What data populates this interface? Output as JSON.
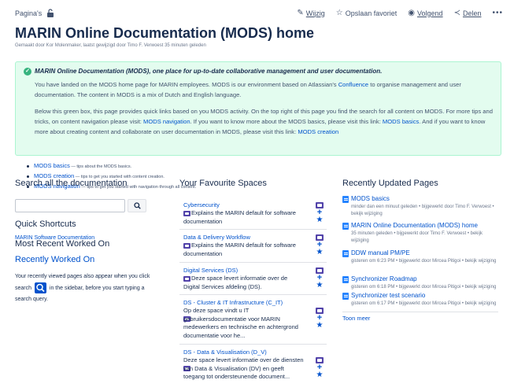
{
  "breadcrumb": {
    "label": "Pagina's"
  },
  "actions": [
    {
      "label": "Wijzig",
      "icon": "pencil-icon"
    },
    {
      "label": "Opslaan favoriet",
      "icon": "star-icon"
    },
    {
      "label": "Volgend",
      "icon": "eye-icon"
    },
    {
      "label": "Delen",
      "icon": "share-icon"
    }
  ],
  "page": {
    "title": "MARIN Online Documentation (MODS) home",
    "byline": "Gemaakt door Kor Molenmaker, laatst gewijzigd door Timo F. Verwoest 35 minuten geleden"
  },
  "panel": {
    "heading": "MARIN Online Documentation (MODS), one place for up-to-date collaborative management and user documentation.",
    "p1_a": "You have landed on the MODS home page for MARIN employees. MODS is our environment based on Atlassian's ",
    "p1_link": "Confluence",
    "p1_b": " to organise management and user documentation. The content in MODS is a mix of Dutch and English language.",
    "p2_a": "Below this green box, this page provides quick links based on you MODS activity. On the top right of this page you find the search for all content on MODS. For more tips and tricks, on content navigation please visit: ",
    "p2_link1": "MODS navigation",
    "p2_b": ". If you want to know more about the MODS basics, please visit this link: ",
    "p2_link2": "MODS basics",
    "p2_c": ". And if you want to know more about creating content and collaborate on user documentation in MODS, please visit this link: ",
    "p2_link3": "MODS creation"
  },
  "quicklinks": [
    {
      "label": "MODS basics",
      "desc": " — tips about the MODS basics."
    },
    {
      "label": "MODS creation",
      "desc": " — tips to get you started with content creation."
    },
    {
      "label": "MODS navigation",
      "desc": " — tips to get you started with navigation through all content."
    }
  ],
  "left": {
    "search_heading": "Search all the documentation",
    "search_placeholder": "",
    "shortcuts_heading": "Quick Shortcuts",
    "shortcut_link": "MARIN Software Documentation",
    "recent_heading": "Most Recent Worked On",
    "recently_worked_on": "Recently Worked On",
    "rwo_a": "Your recently viewed pages also appear when you click search ",
    "rwo_b": " in the sidebar, before you start typing a search query."
  },
  "spaces": {
    "heading": "Your Favourite Spaces",
    "items": [
      {
        "name": "Cybersecurity",
        "desc": "Explains the MARIN default for software documentation"
      },
      {
        "name": "Data & Delivery Workflow",
        "desc": "Explains the MARIN default for software documentation"
      },
      {
        "name": "Digital Services (DS)",
        "desc": "Deze space levert informatie over de Digital Services afdeling (DS)."
      },
      {
        "name": "DS - Cluster & IT Infrastructure (C_IT)",
        "desc": "Op deze space vindt u IT gebruikersdocumentatie voor MARIN medewerkers en technische en achtergrond documentatie voor he..."
      },
      {
        "name": "DS - Data & Visualisation (D_V)",
        "desc": "Deze space levert informatie over de diensten van Data & Visualisation (DV) en geeft toegang tot ondersteunende document..."
      }
    ]
  },
  "recent": {
    "heading": "Recently Updated Pages",
    "items": [
      {
        "title": "MODS basics",
        "meta": "minder dan een minuut geleden • bijgewerkt door Timo F. Verwoest • bekijk wijziging"
      },
      {
        "title": "MARIN Online Documentation (MODS) home",
        "meta": "35 minuten geleden • bijgewerkt door Timo F. Verwoest • bekijk wijziging"
      },
      {
        "title": "DDW manual PM/PE",
        "meta": "gisteren om 6:23 PM • bijgewerkt door Mircea Pitigoi • bekijk wijziging"
      },
      {
        "title": "Synchronizer Roadmap",
        "meta": "gisteren om 6:18 PM • bijgewerkt door Mircea Pitigoi • bekijk wijziging"
      },
      {
        "title": "Synchronizer test scenario",
        "meta": "gisteren om 6:17 PM • bijgewerkt door Mircea Pitigoi • bekijk wijziging"
      }
    ],
    "more": "Toon meer"
  },
  "colors": {
    "link": "#0052cc",
    "panel_bg": "#e3fcef",
    "success": "#36b37e",
    "space_icon": "#5243aa"
  }
}
